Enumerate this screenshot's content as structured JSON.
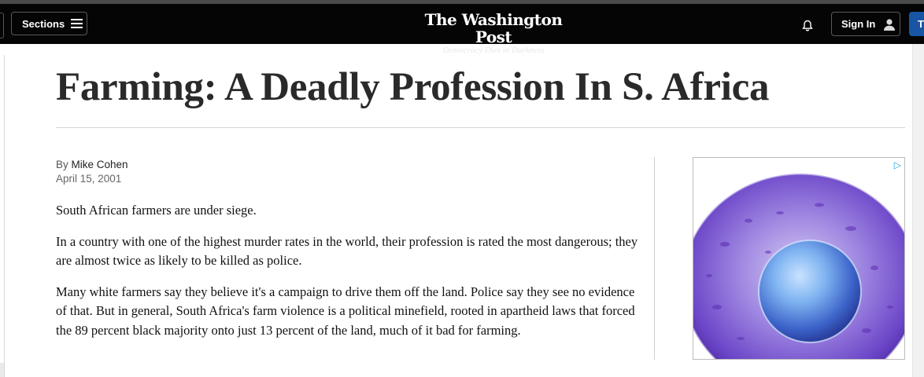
{
  "header": {
    "sections_label": "Sections",
    "brand_name": "The Washington Post",
    "brand_tagline": "Democracy Dies in Darkness",
    "signin_label": "Sign In",
    "subscribe_label": "T",
    "icons": [
      "menu-icon",
      "bell-icon",
      "user-icon"
    ]
  },
  "article": {
    "headline": "Farming: A Deadly Profession In S. Africa",
    "byline_prefix": "By",
    "author": "Mike Cohen",
    "date": "April 15, 2001",
    "paragraphs": [
      "South African farmers are under siege.",
      "In a country with one of the highest murder rates in the world, their profession is rated the most dangerous; they are almost twice as likely to be killed as police.",
      "Many white farmers say they believe it's a campaign to drive them off the land. Police say they see no evidence of that. But in general, South Africa's farm violence is a political minefield, rooted in apartheid laws that forced the 89 percent black majority onto just 13 percent of the land, much of it bad for farming."
    ]
  },
  "ad": {
    "choices_icon": "ad-choices-icon",
    "image": "cell-microscopy-image"
  },
  "colors": {
    "navbar": "#050505",
    "subscribe": "#1955a5",
    "text": "#2a2a2a"
  }
}
